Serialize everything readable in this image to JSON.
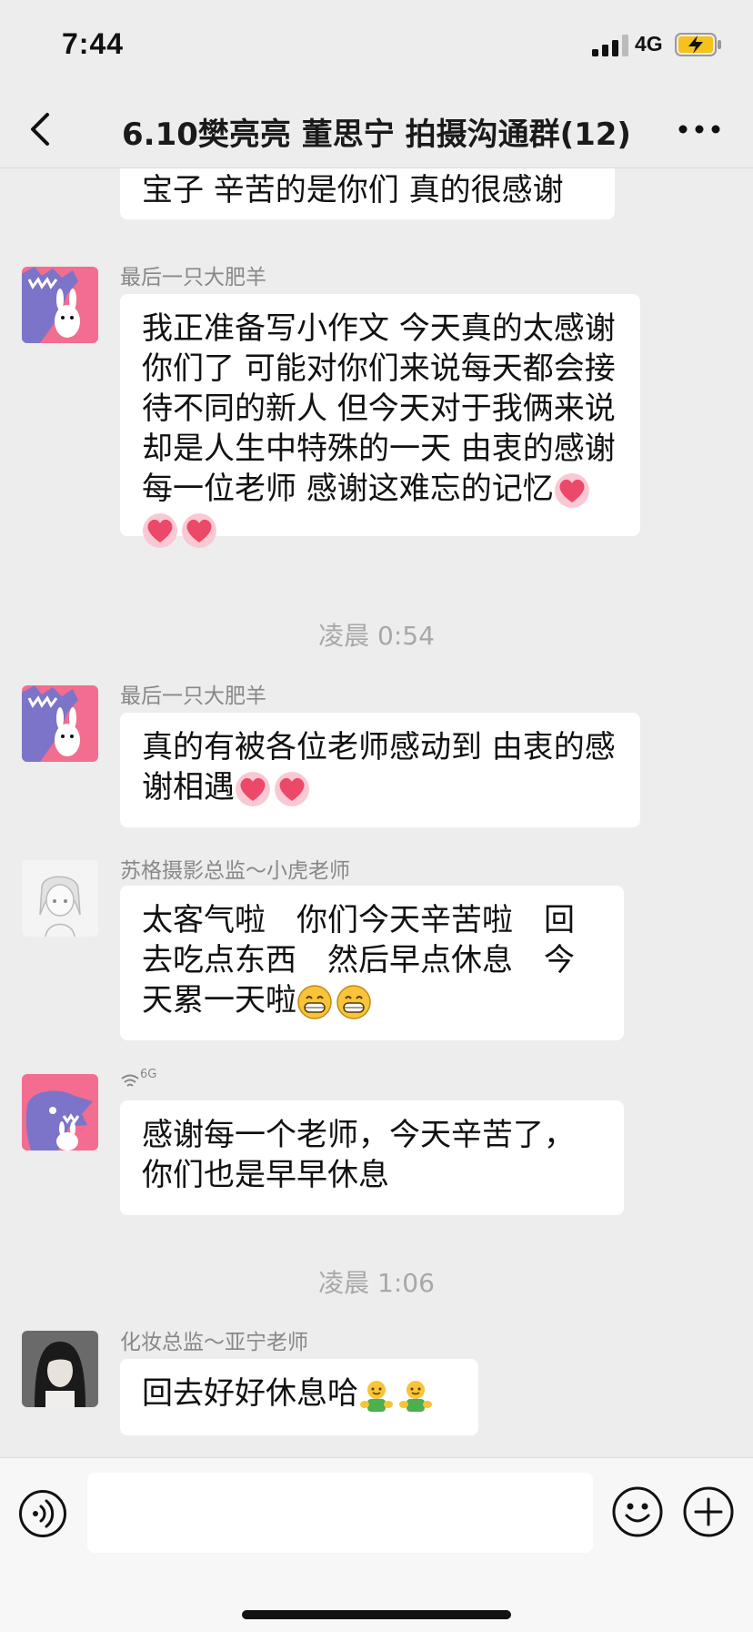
{
  "status": {
    "time": "7:44",
    "network": "4G"
  },
  "header": {
    "title": "6.10樊亮亮 董思宁 拍摄沟通群(12)"
  },
  "messages": [
    {
      "text": "宝子 辛苦的是你们 真的很感谢"
    },
    {
      "sender": "最后一只大肥羊",
      "text": "我正准备写小作文 今天真的太感谢你们了 可能对你们来说每天都会接待不同的新人 但今天对于我俩来说却是人生中特殊的一天 由衷的感谢每一位老师 感谢这难忘的记忆",
      "emojis": [
        "heart-emoji",
        "heart-emoji",
        "heart-emoji"
      ]
    },
    {
      "timestamp": "凌晨 0:54"
    },
    {
      "sender": "最后一只大肥羊",
      "text": "真的有被各位老师感动到 由衷的感谢相遇",
      "emojis": [
        "heart-emoji",
        "heart-emoji"
      ]
    },
    {
      "sender": "苏格摄影总监～小虎老师",
      "text": "太客气啦　你们今天辛苦啦　回去吃点东西　然后早点休息　今天累一天啦",
      "emojis": [
        "grin-emoji",
        "grin-emoji"
      ]
    },
    {
      "sender": "6G",
      "text": "感谢每一个老师，今天辛苦了，你们也是早早休息"
    },
    {
      "timestamp": "凌晨 1:06"
    },
    {
      "sender": "化妆总监～亚宁老师",
      "text": "回去好好休息哈",
      "emojis": [
        "hug-emoji",
        "hug-emoji"
      ]
    }
  ],
  "colors": {
    "background": "#ededed",
    "bubble": "#ffffff",
    "avatar_pink": "#f26d8f",
    "avatar_purple": "#7c74c9"
  }
}
